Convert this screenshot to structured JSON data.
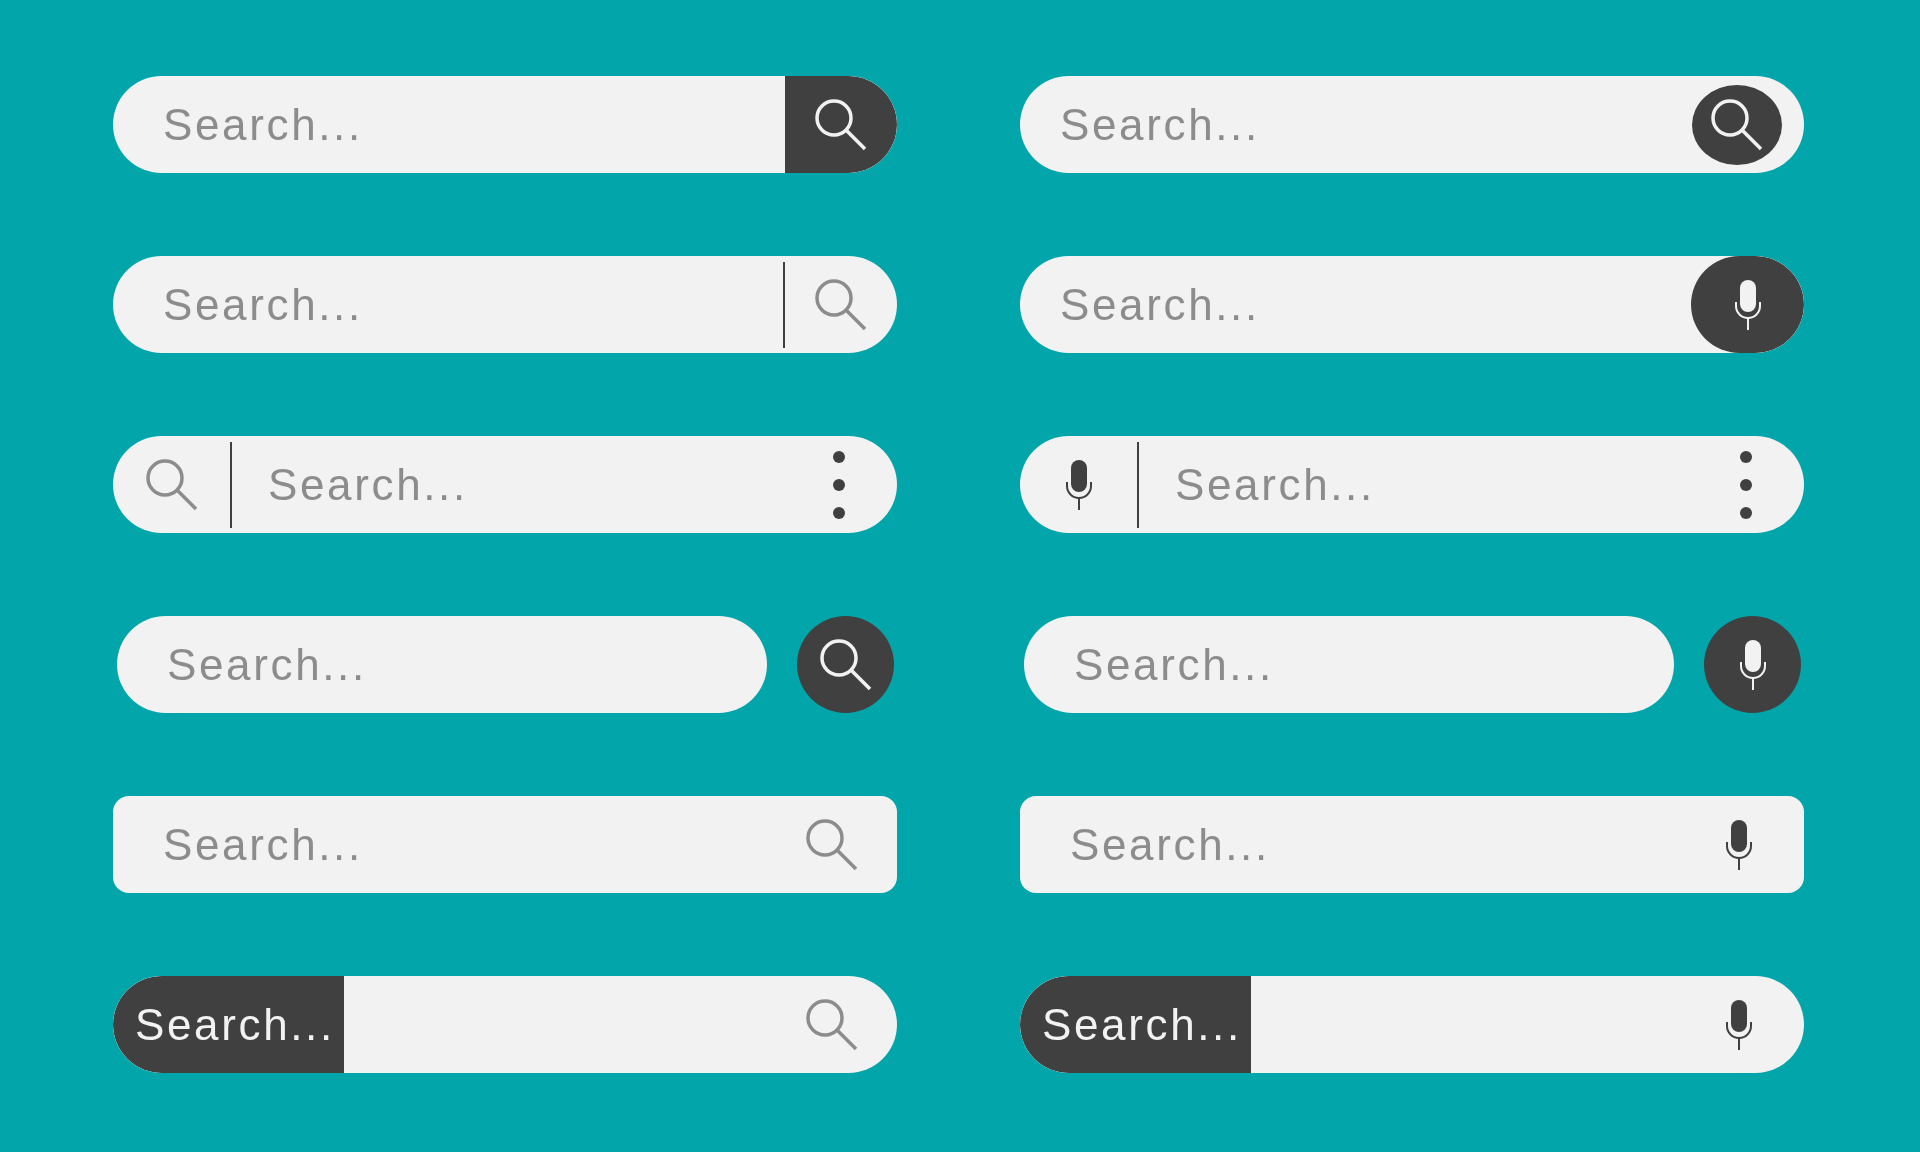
{
  "bars": [
    {
      "kind": "button-block",
      "placeholder": "Search..."
    },
    {
      "kind": "inset-oval",
      "placeholder": "Search..."
    },
    {
      "kind": "divider-icon",
      "placeholder": "Search..."
    },
    {
      "kind": "end-circle",
      "placeholder": "Search..."
    },
    {
      "kind": "left-icon-menu",
      "placeholder": "Search..."
    },
    {
      "kind": "left-icon-menu",
      "placeholder": "Search..."
    },
    {
      "kind": "detached-button",
      "placeholder": "Search..."
    },
    {
      "kind": "detached-button",
      "placeholder": "Search..."
    },
    {
      "kind": "rounded-rect",
      "placeholder": "Search..."
    },
    {
      "kind": "rounded-rect",
      "placeholder": "Search..."
    },
    {
      "kind": "label-block",
      "label": "Search..."
    },
    {
      "kind": "label-block",
      "label": "Search..."
    }
  ]
}
